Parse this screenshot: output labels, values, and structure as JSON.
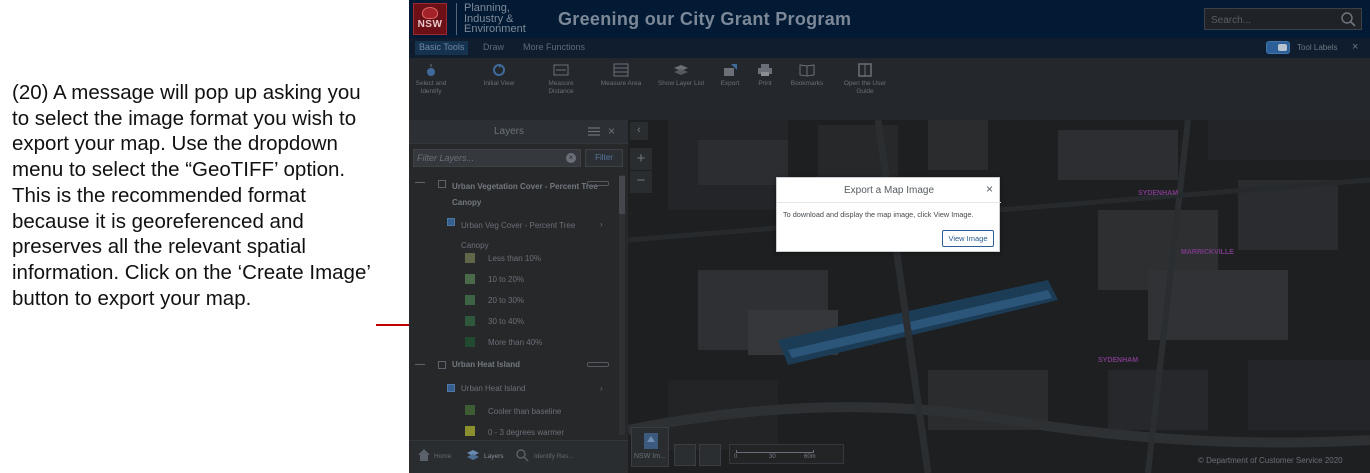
{
  "instruction_text": "(20) A message will pop up asking you to select the image format you wish to export your map. Use the dropdown menu to select the “GeoTIFF’ option. This is the recommended format because it is georeferenced and preserves all the relevant spatial information. Click on the ‘Create Image’ button to export your map.",
  "colors": {
    "annotation": "#c00000",
    "header_bg": "#021a33",
    "accent": "#2d5f95"
  },
  "header": {
    "logo_text": "NSW",
    "org_lines": [
      "Planning,",
      "Industry &",
      "Environment"
    ],
    "title": "Greening our City Grant Program",
    "search_placeholder": "Search..."
  },
  "tabs": [
    "Basic Tools",
    "Draw",
    "More Functions"
  ],
  "tool_labels_toggle": "Tool Labels",
  "tab_close": "×",
  "toolbar": [
    {
      "label": "Select and Identify",
      "icon": "select-identify-icon"
    },
    {
      "label": "Initial View",
      "icon": "initial-view-icon"
    },
    {
      "label": "Measure Distance",
      "icon": "measure-distance-icon"
    },
    {
      "label": "Measure Area",
      "icon": "measure-area-icon"
    },
    {
      "label": "Show Layer List",
      "icon": "layer-list-icon"
    },
    {
      "label": "Export",
      "icon": "export-icon"
    },
    {
      "label": "Print",
      "icon": "print-icon"
    },
    {
      "label": "Bookmarks",
      "icon": "bookmarks-icon"
    },
    {
      "label": "Open the User Guide",
      "icon": "user-guide-icon"
    }
  ],
  "layers_panel": {
    "title": "Layers",
    "close": "×",
    "filter_placeholder": "Filter Layers...",
    "filter_clear": "×",
    "filter_button": "Filter",
    "group1": {
      "title": "Urban Vegetation Cover - Percent Tree Canopy",
      "sublayer": "Urban Veg Cover - Percent Tree Canopy",
      "legend": [
        {
          "label": "Less than 10%",
          "color": "#5f6649"
        },
        {
          "label": "10 to 20%",
          "color": "#4a6a4a"
        },
        {
          "label": "20 to 30%",
          "color": "#3c6344"
        },
        {
          "label": "30 to 40%",
          "color": "#2e573b"
        },
        {
          "label": "More than 40%",
          "color": "#214a30"
        }
      ]
    },
    "group2": {
      "title": "Urban Heat Island",
      "sublayer": "Urban Heat Island",
      "legend": [
        {
          "label": "Cooler than baseline",
          "color": "#3d5c33"
        },
        {
          "label": "0 - 3 degrees warmer",
          "color": "#8b8f2e"
        }
      ]
    },
    "collapse_symbol": "—",
    "footer_tabs": [
      "Home",
      "Layers",
      "Identify Res..."
    ]
  },
  "map": {
    "collapse_symbol": "‹",
    "zoom_in": "+",
    "zoom_out": "−",
    "labels": [
      "SYDENHAM",
      "MARRICKVILLE",
      "SYDENHAM"
    ],
    "basemap_label": "NSW Im...",
    "scale": [
      "0",
      "30",
      "60m"
    ],
    "copyright": "© Department of Customer Service 2020"
  },
  "dialog": {
    "title": "Export a Map Image",
    "close": "×",
    "message": "To download and display the map image, click View Image.",
    "button": "View Image"
  }
}
